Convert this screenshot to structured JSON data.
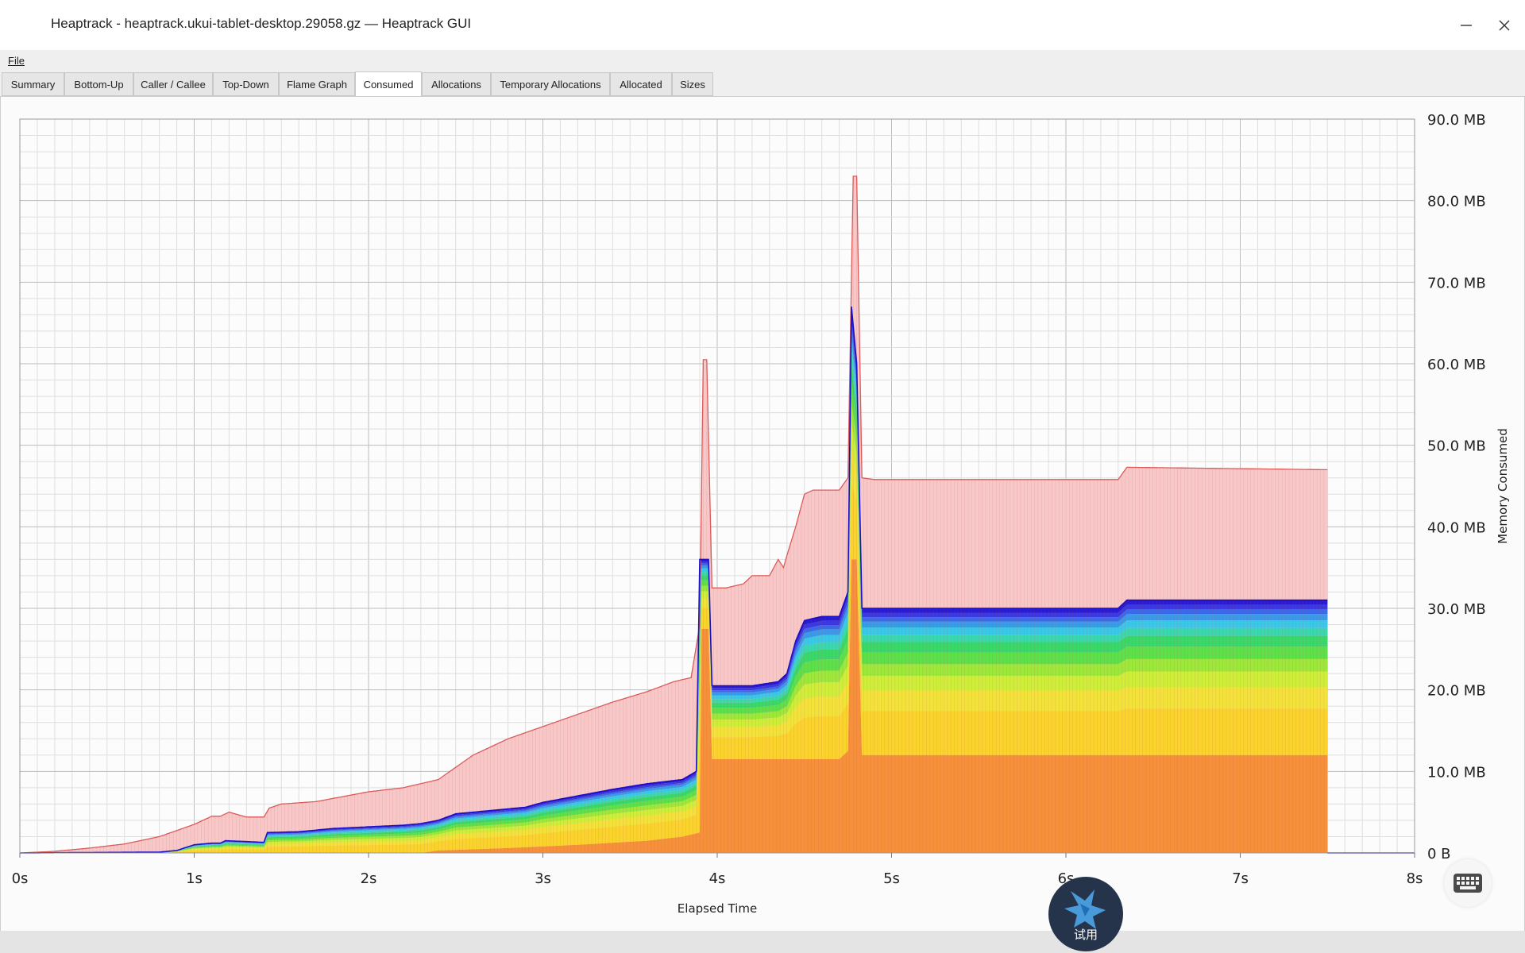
{
  "window": {
    "title": "Heaptrack - heaptrack.ukui-tablet-desktop.29058.gz — Heaptrack GUI"
  },
  "menu": {
    "file": "File"
  },
  "tabs": [
    {
      "label": "Summary",
      "active": false
    },
    {
      "label": "Bottom-Up",
      "active": false
    },
    {
      "label": "Caller / Callee",
      "active": false
    },
    {
      "label": "Top-Down",
      "active": false
    },
    {
      "label": "Flame Graph",
      "active": false
    },
    {
      "label": "Consumed",
      "active": true
    },
    {
      "label": "Allocations",
      "active": false
    },
    {
      "label": "Temporary Allocations",
      "active": false
    },
    {
      "label": "Allocated",
      "active": false
    },
    {
      "label": "Sizes",
      "active": false
    }
  ],
  "overlay": {
    "badge_label": "试用",
    "keyboard_icon": "keyboard-icon"
  },
  "colors": {
    "total_fill": "#f8c8c8",
    "total_line": "#dc5a5a",
    "layers": [
      "#f7903a",
      "#fad32c",
      "#f3e23a",
      "#cfee3a",
      "#9de83a",
      "#5ee04a",
      "#3ad86a",
      "#3ad8b0",
      "#3ac8e8",
      "#3a9ae8",
      "#3a6ae8",
      "#3a38e0",
      "#2a1ad0"
    ]
  },
  "chart_data": {
    "type": "area",
    "xlabel": "Elapsed Time",
    "ylabel": "Memory Consumed",
    "xlim": [
      0,
      8
    ],
    "ylim": [
      0,
      90
    ],
    "x_ticks": [
      "0s",
      "1s",
      "2s",
      "3s",
      "4s",
      "5s",
      "6s",
      "7s",
      "8s"
    ],
    "y_ticks": [
      "0 B",
      "10.0 MB",
      "20.0 MB",
      "30.0 MB",
      "40.0 MB",
      "50.0 MB",
      "60.0 MB",
      "70.0 MB",
      "80.0 MB",
      "90.0 MB"
    ],
    "y_unit": "MB",
    "grid": true,
    "series": [
      {
        "role": "total",
        "points": [
          [
            0,
            0
          ],
          [
            0.2,
            0.2
          ],
          [
            0.4,
            0.6
          ],
          [
            0.6,
            1.1
          ],
          [
            0.8,
            2.0
          ],
          [
            1.0,
            3.5
          ],
          [
            1.1,
            4.5
          ],
          [
            1.15,
            4.5
          ],
          [
            1.2,
            5.0
          ],
          [
            1.3,
            4.4
          ],
          [
            1.4,
            4.4
          ],
          [
            1.43,
            5.5
          ],
          [
            1.5,
            6.0
          ],
          [
            1.7,
            6.3
          ],
          [
            2.0,
            7.5
          ],
          [
            2.2,
            8.0
          ],
          [
            2.4,
            9.0
          ],
          [
            2.6,
            12.0
          ],
          [
            2.8,
            14.0
          ],
          [
            3.0,
            15.5
          ],
          [
            3.2,
            17.0
          ],
          [
            3.4,
            18.5
          ],
          [
            3.6,
            19.8
          ],
          [
            3.75,
            21.0
          ],
          [
            3.85,
            21.5
          ],
          [
            3.9,
            28.0
          ],
          [
            3.92,
            60.5
          ],
          [
            3.94,
            60.5
          ],
          [
            3.97,
            32.5
          ],
          [
            4.05,
            32.5
          ],
          [
            4.15,
            33.0
          ],
          [
            4.2,
            34.0
          ],
          [
            4.3,
            34.0
          ],
          [
            4.35,
            36.0
          ],
          [
            4.38,
            35.0
          ],
          [
            4.4,
            36.5
          ],
          [
            4.45,
            40.0
          ],
          [
            4.5,
            44.0
          ],
          [
            4.55,
            44.5
          ],
          [
            4.7,
            44.5
          ],
          [
            4.75,
            46.0
          ],
          [
            4.78,
            83.0
          ],
          [
            4.8,
            83.0
          ],
          [
            4.83,
            46.0
          ],
          [
            4.9,
            45.8
          ],
          [
            6.3,
            45.8
          ],
          [
            6.35,
            47.3
          ],
          [
            7.5,
            47.0
          ]
        ]
      },
      {
        "role": "layer-stack-top",
        "points": [
          [
            0,
            0
          ],
          [
            0.8,
            0.1
          ],
          [
            0.9,
            0.3
          ],
          [
            1.0,
            1.0
          ],
          [
            1.1,
            1.2
          ],
          [
            1.15,
            1.2
          ],
          [
            1.18,
            1.5
          ],
          [
            1.4,
            1.3
          ],
          [
            1.42,
            2.5
          ],
          [
            1.6,
            2.6
          ],
          [
            1.8,
            3.0
          ],
          [
            2.0,
            3.2
          ],
          [
            2.2,
            3.4
          ],
          [
            2.3,
            3.6
          ],
          [
            2.4,
            4.0
          ],
          [
            2.5,
            4.8
          ],
          [
            2.7,
            5.2
          ],
          [
            2.9,
            5.6
          ],
          [
            3.0,
            6.2
          ],
          [
            3.2,
            7.0
          ],
          [
            3.4,
            7.8
          ],
          [
            3.6,
            8.5
          ],
          [
            3.8,
            9.0
          ],
          [
            3.88,
            10.0
          ],
          [
            3.9,
            36.0
          ],
          [
            3.95,
            36.0
          ],
          [
            3.97,
            20.5
          ],
          [
            4.2,
            20.5
          ],
          [
            4.35,
            21.0
          ],
          [
            4.4,
            22.0
          ],
          [
            4.45,
            26.0
          ],
          [
            4.5,
            28.5
          ],
          [
            4.6,
            29.0
          ],
          [
            4.7,
            29.0
          ],
          [
            4.75,
            32.0
          ],
          [
            4.77,
            67.0
          ],
          [
            4.8,
            60.0
          ],
          [
            4.83,
            30.0
          ],
          [
            6.3,
            30.0
          ],
          [
            6.35,
            31.0
          ],
          [
            7.5,
            31.0
          ]
        ]
      },
      {
        "role": "base-layer",
        "points": [
          [
            0,
            0
          ],
          [
            2.3,
            0
          ],
          [
            2.4,
            0.3
          ],
          [
            2.8,
            0.6
          ],
          [
            3.2,
            1.0
          ],
          [
            3.6,
            1.5
          ],
          [
            3.8,
            2.0
          ],
          [
            3.9,
            2.5
          ],
          [
            3.91,
            27.5
          ],
          [
            3.95,
            27.5
          ],
          [
            3.97,
            11.5
          ],
          [
            4.7,
            11.5
          ],
          [
            4.75,
            12.5
          ],
          [
            4.77,
            36.0
          ],
          [
            4.8,
            36.0
          ],
          [
            4.83,
            12.0
          ],
          [
            7.5,
            12.0
          ]
        ]
      }
    ]
  }
}
